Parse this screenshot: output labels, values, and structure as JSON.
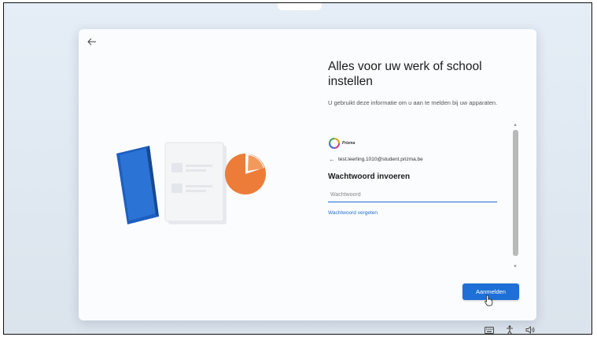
{
  "setup": {
    "title": "Alles voor uw werk of school instellen",
    "subtitle": "U gebruikt deze informatie om u aan te melden bij uw apparaten."
  },
  "signin": {
    "logo_text": "Prizma",
    "account_email": "test.leerling.1010@student.prizma.be",
    "password_heading": "Wachtwoord invoeren",
    "password_placeholder": "Wachtwoord",
    "password_value": "",
    "forgot_link": "Wachtwoord vergeten",
    "submit_label": "Aanmelden"
  },
  "icons": {
    "back": "arrow-left-icon",
    "account_back": "arrow-left-icon",
    "keyboard": "keyboard-icon",
    "accessibility": "accessibility-icon",
    "volume": "volume-icon",
    "cursor": "hand-pointer-icon"
  },
  "colors": {
    "accent": "#1e6fd6",
    "link": "#1f6ed4",
    "background": "#e0e8f1",
    "card": "#fbfcfd"
  }
}
